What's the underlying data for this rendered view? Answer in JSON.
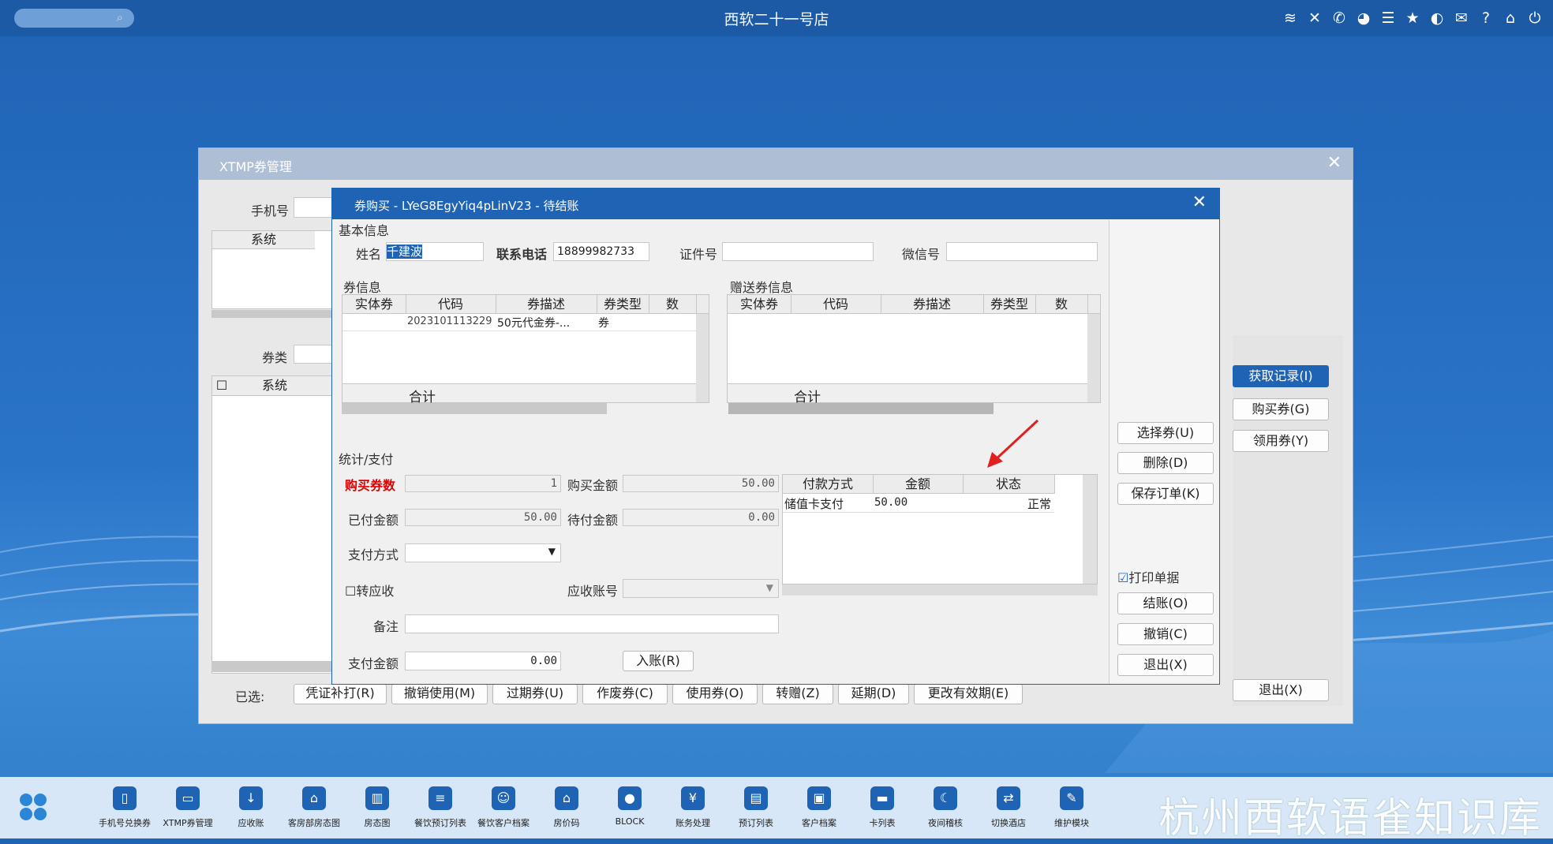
{
  "topbar": {
    "title": "西软二十一号店",
    "icons": [
      "wifi-icon",
      "tools-icon",
      "phone-icon",
      "palette-icon",
      "menu-icon",
      "star-icon",
      "moon-icon",
      "mail-icon",
      "help-icon",
      "home-icon",
      "power-icon"
    ]
  },
  "bg": {
    "title": "XTMP券管理",
    "phone_label": "手机号",
    "type_label": "券类",
    "col_system": "系统",
    "selected_label": "已选:",
    "bottom_buttons": [
      "凭证补打(R)",
      "撤销使用(M)",
      "过期券(U)",
      "作废券(C)",
      "使用券(O)",
      "转赠(Z)",
      "延期(D)",
      "更改有效期(E)"
    ],
    "right_buttons": [
      "获取记录(I)",
      "购买券(G)",
      "领用券(Y)"
    ],
    "exit": "退出(X)"
  },
  "dialog": {
    "title": "券购买 - LYeG8EgyYiq4pLinV23 - 待结账",
    "basic_section": "基本信息",
    "name_label": "姓名",
    "name_value": "千建波",
    "phone_label": "联系电话",
    "phone_value": "18899982733",
    "id_label": "证件号",
    "wechat_label": "微信号",
    "coupon_section": "券信息",
    "gift_section": "赠送券信息",
    "cols": [
      "实体券",
      "代码",
      "券描述",
      "券类型",
      "数"
    ],
    "row": {
      "code": "2023101113229",
      "desc": "50元代金券-...",
      "type": "券"
    },
    "total_label": "合计",
    "pay_section": "统计/支付",
    "qty_label": "购买券数",
    "qty_value": "1",
    "amount_label": "购买金额",
    "amount_value": "50.00",
    "paid_label": "已付金额",
    "paid_value": "50.00",
    "pending_label": "待付金额",
    "pending_value": "0.00",
    "method_label": "支付方式",
    "receivable_label": "转应收",
    "account_label": "应收账号",
    "remark_label": "备注",
    "payamt_label": "支付金额",
    "payamt_value": "0.00",
    "post_button": "入账(R)",
    "pay_cols": [
      "付款方式",
      "金额",
      "状态"
    ],
    "pay_row": {
      "method": "储值卡支付",
      "amount": "50.00",
      "status": "正常"
    },
    "side_buttons": [
      "选择券(U)",
      "删除(D)",
      "保存订单(K)"
    ],
    "print_label": "打印单据",
    "action_buttons": [
      "结账(O)",
      "撤销(C)",
      "退出(X)"
    ]
  },
  "taskbar": [
    {
      "label": "手机号兑换券",
      "icon": "phone-card-icon"
    },
    {
      "label": "XTMP券管理",
      "icon": "coupon-icon"
    },
    {
      "label": "应收账",
      "icon": "receivable-icon"
    },
    {
      "label": "客房部房态图",
      "icon": "room-map-icon"
    },
    {
      "label": "房态图",
      "icon": "building-icon"
    },
    {
      "label": "餐饮预订列表",
      "icon": "list-icon"
    },
    {
      "label": "餐饮客户档案",
      "icon": "customer-icon"
    },
    {
      "label": "房价码",
      "icon": "house-icon"
    },
    {
      "label": "BLOCK",
      "icon": "lock-icon"
    },
    {
      "label": "账务处理",
      "icon": "accounting-icon"
    },
    {
      "label": "预订列表",
      "icon": "booking-icon"
    },
    {
      "label": "客户档案",
      "icon": "profile-icon"
    },
    {
      "label": "卡列表",
      "icon": "card-icon"
    },
    {
      "label": "夜间稽核",
      "icon": "night-audit-icon"
    },
    {
      "label": "切换酒店",
      "icon": "switch-icon"
    },
    {
      "label": "维护模块",
      "icon": "wrench-icon"
    }
  ],
  "watermark": "杭州西软语雀知识库"
}
